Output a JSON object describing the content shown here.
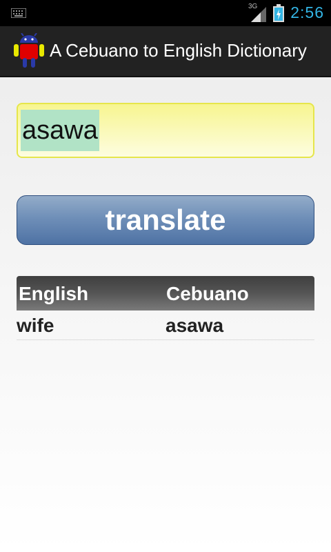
{
  "status_bar": {
    "network_label": "3G",
    "time": "2:56"
  },
  "action_bar": {
    "title": "A Cebuano to English Dictionary",
    "icon": "android-app-icon"
  },
  "search": {
    "value": "asawa"
  },
  "translate_button": {
    "label": "translate"
  },
  "results": {
    "headers": [
      "English",
      "Cebuano"
    ],
    "rows": [
      [
        "wife",
        "asawa"
      ]
    ]
  },
  "colors": {
    "status_accent": "#33b5e5",
    "button_blue": "#6f8fb8",
    "input_yellow": "#f7f590",
    "selection_green": "#b1e3c6"
  }
}
